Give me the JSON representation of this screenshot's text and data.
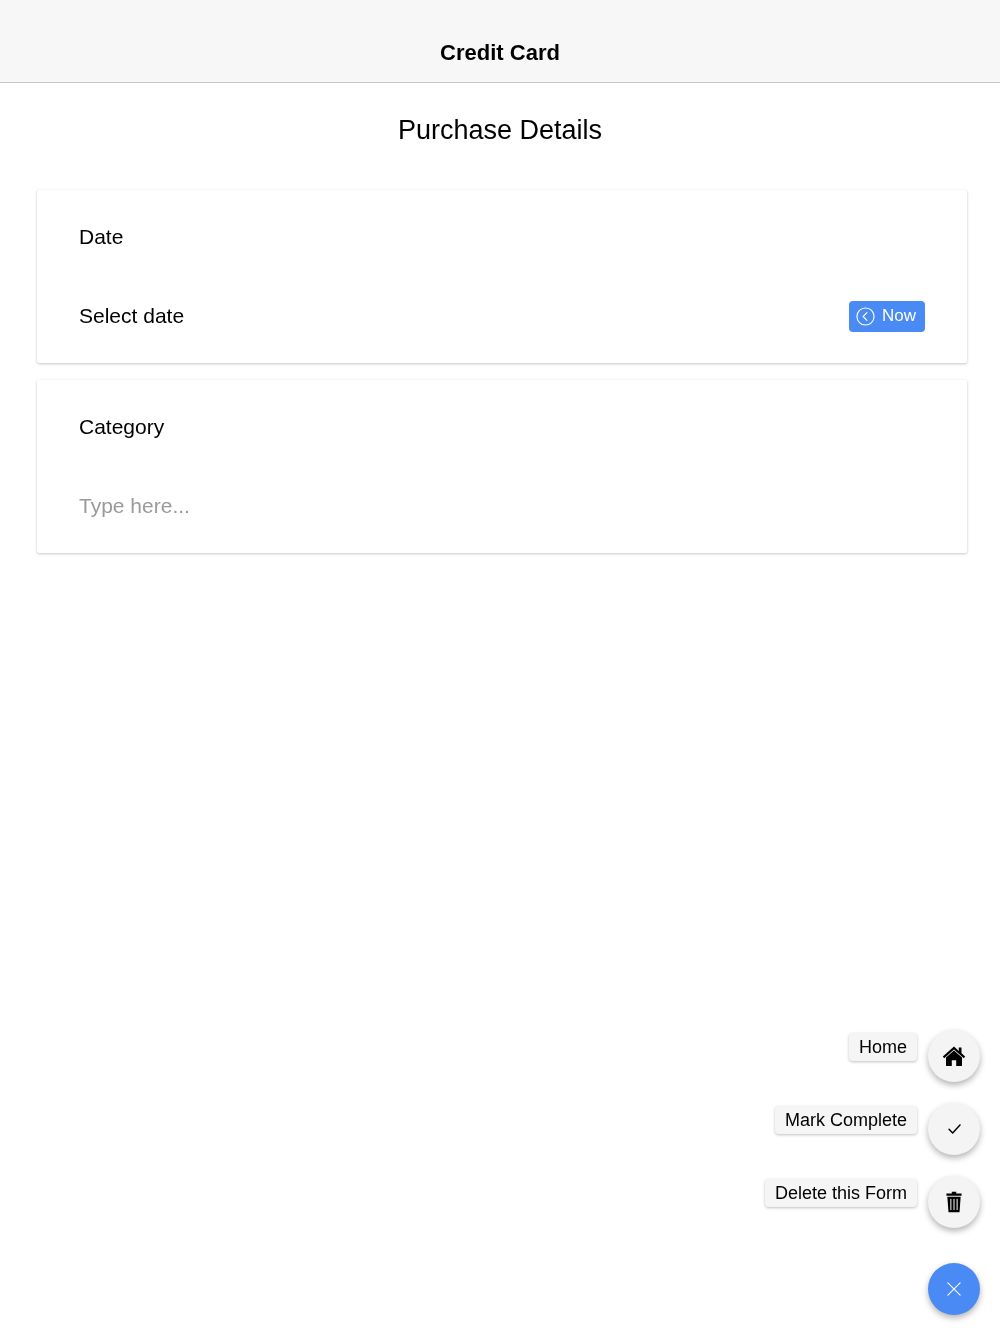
{
  "nav_bar": {
    "title": "Credit Card"
  },
  "page_title": "Purchase Details",
  "fields": [
    {
      "kind": "date",
      "label": "Date",
      "value": "Select date",
      "button": "Now"
    },
    {
      "kind": "text",
      "label": "Category",
      "placeholder": "Type here..."
    }
  ],
  "speed_dial": {
    "expanded": true,
    "actions": [
      {
        "kind": "home",
        "label": "Home"
      },
      {
        "kind": "check",
        "label": "Mark Complete"
      },
      {
        "kind": "trash",
        "label": "Delete this Form"
      }
    ]
  }
}
